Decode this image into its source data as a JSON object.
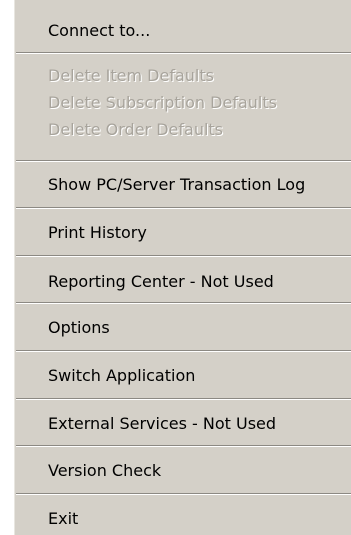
{
  "menu": {
    "items": [
      {
        "label": "Connect to...",
        "enabled": true,
        "has_submenu": true
      },
      {
        "label": "Delete Item Defaults",
        "enabled": false,
        "has_submenu": false
      },
      {
        "label": "Delete Subscription Defaults",
        "enabled": false,
        "has_submenu": false
      },
      {
        "label": "Delete Order Defaults",
        "enabled": false,
        "has_submenu": false
      },
      {
        "label": "Show PC/Server Transaction Log",
        "enabled": true,
        "has_submenu": false
      },
      {
        "label": "Print History",
        "enabled": true,
        "has_submenu": false
      },
      {
        "label": "Reporting Center - Not Used",
        "enabled": true,
        "has_submenu": false
      },
      {
        "label": "Options",
        "enabled": true,
        "has_submenu": true
      },
      {
        "label": "Switch Application",
        "enabled": true,
        "has_submenu": true
      },
      {
        "label": "External Services - Not Used",
        "enabled": true,
        "has_submenu": true
      },
      {
        "label": "Version Check",
        "enabled": true,
        "has_submenu": false
      },
      {
        "label": "Exit",
        "enabled": true,
        "has_submenu": false
      }
    ]
  }
}
